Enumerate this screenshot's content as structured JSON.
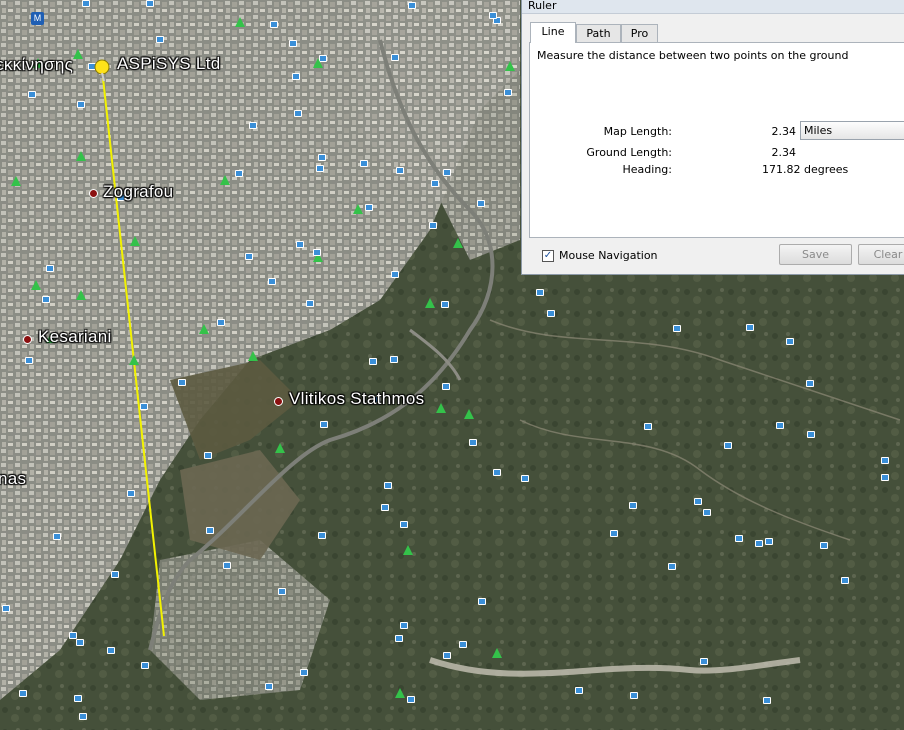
{
  "map": {
    "places": [
      {
        "id": "aspisys",
        "label": "ASPiSYS Ltd"
      },
      {
        "id": "ekkinisis",
        "label": "εκκίνησης"
      },
      {
        "id": "zografou",
        "label": "Zografou"
      },
      {
        "id": "kesariani",
        "label": "Kesariani"
      },
      {
        "id": "vlitikos",
        "label": "Vlitikos Stathmos"
      },
      {
        "id": "nas",
        "label": "nas"
      }
    ],
    "measure_line_color": "#f2f200",
    "badge_letter": "M"
  },
  "ruler": {
    "window_title": "Ruler",
    "tabs": [
      {
        "label": "Line",
        "active": true
      },
      {
        "label": "Path",
        "active": false
      },
      {
        "label": "Pro",
        "active": false
      }
    ],
    "description": "Measure the distance between two points on the ground",
    "map_length_label": "Map Length:",
    "map_length_value": "2.34",
    "unit_selected": "Miles",
    "ground_length_label": "Ground Length:",
    "ground_length_value": "2.34",
    "heading_label": "Heading:",
    "heading_value": "171.82 degrees",
    "mouse_navigation_label": "Mouse Navigation",
    "mouse_navigation_checked": true,
    "save_label": "Save",
    "clear_label": "Clear"
  }
}
